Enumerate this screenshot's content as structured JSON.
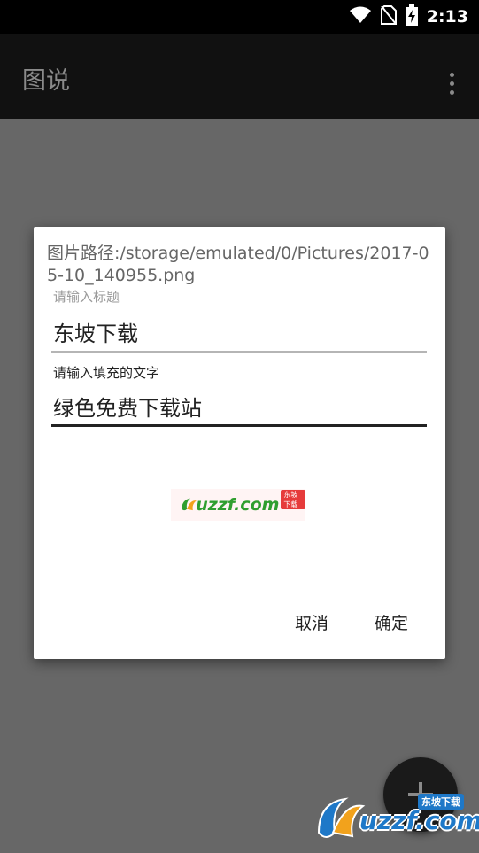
{
  "status_bar": {
    "time": "2:13",
    "icons": [
      "wifi-icon",
      "no-sim-icon",
      "battery-charging-icon"
    ]
  },
  "app_bar": {
    "title": "图说",
    "menu_icon": "overflow-menu-icon"
  },
  "dialog": {
    "path_text": "图片路径:/storage/emulated/0/Pictures/2017-05-10_140955.png",
    "title_hint": "请输入标题",
    "title_value": "东坡下载",
    "fill_label": "请输入填充的文字",
    "fill_value": "绿色免费下载站",
    "preview": {
      "logo_text": "uzzf.com",
      "logo_badge": "东坡下载"
    },
    "cancel_label": "取消",
    "confirm_label": "确定"
  },
  "fab": {
    "icon": "plus-icon"
  },
  "watermark": {
    "text": "uzzf.com",
    "badge": "东坡下载"
  },
  "colors": {
    "status_bar": "#000000",
    "app_bar": "#111111",
    "scrim": "#676767",
    "dialog": "#ffffff",
    "accent_green": "#2f9e2f",
    "watermark_blue": "#1e78c8"
  }
}
